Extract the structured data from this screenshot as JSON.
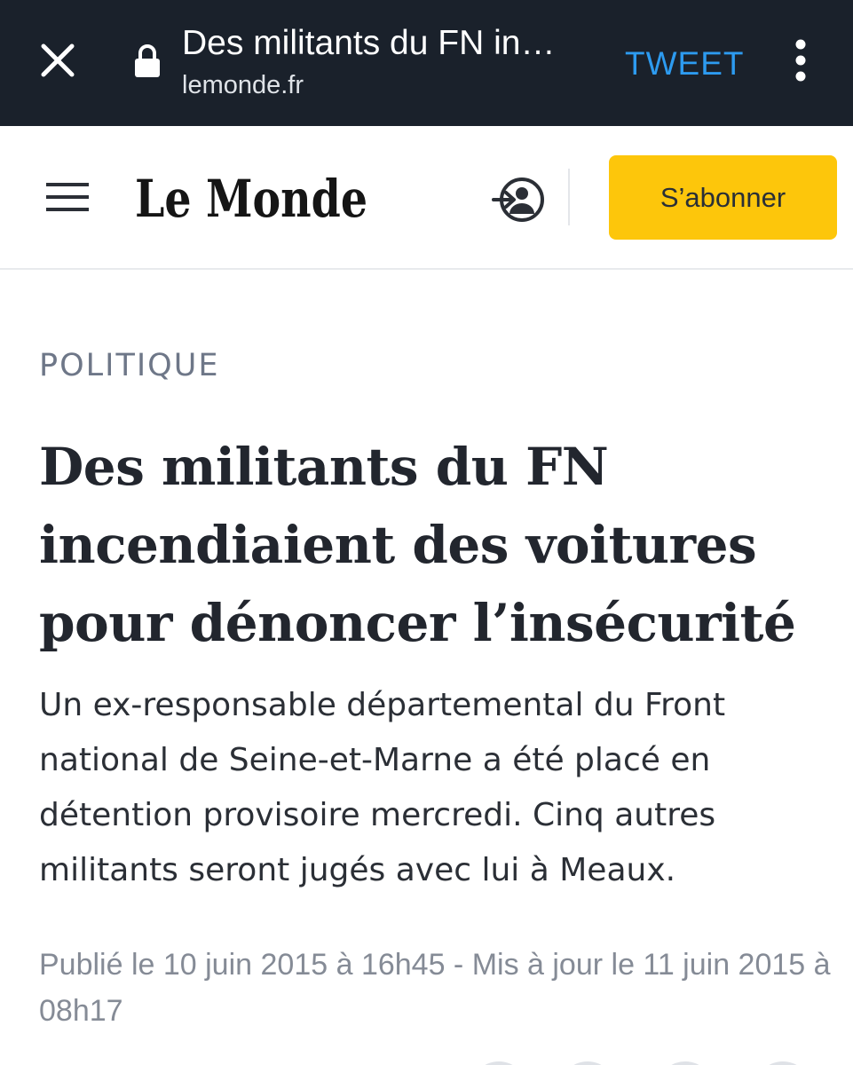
{
  "browser": {
    "tab_title": "Des militants du FN in…",
    "url": "lemonde.fr",
    "tweet_label": "TWEET",
    "icons": [
      "close-icon",
      "lock-icon",
      "more-vert-icon"
    ]
  },
  "site": {
    "logo_text": "Le Monde",
    "subscribe_label": "S’abonner",
    "icons": [
      "menu-icon",
      "login-icon"
    ],
    "accent_color": "#fdc60b",
    "topbar_color": "#1a212b",
    "tweet_color": "#2d9bf0"
  },
  "article": {
    "section": "POLITIQUE",
    "headline": "Des militants du FN incendiaient des voitures pour dénoncer l’insécurité",
    "dek": "Un ex-responsable départemental du Front national de Seine-et-Marne a été placé en détention provisoire mercredi. Cinq autres militants seront jugés avec lui à Meaux.",
    "meta": "Publié le 10 juin 2015 à 16h45 - Mis à jour le 11 juin 2015 à 08h17"
  }
}
